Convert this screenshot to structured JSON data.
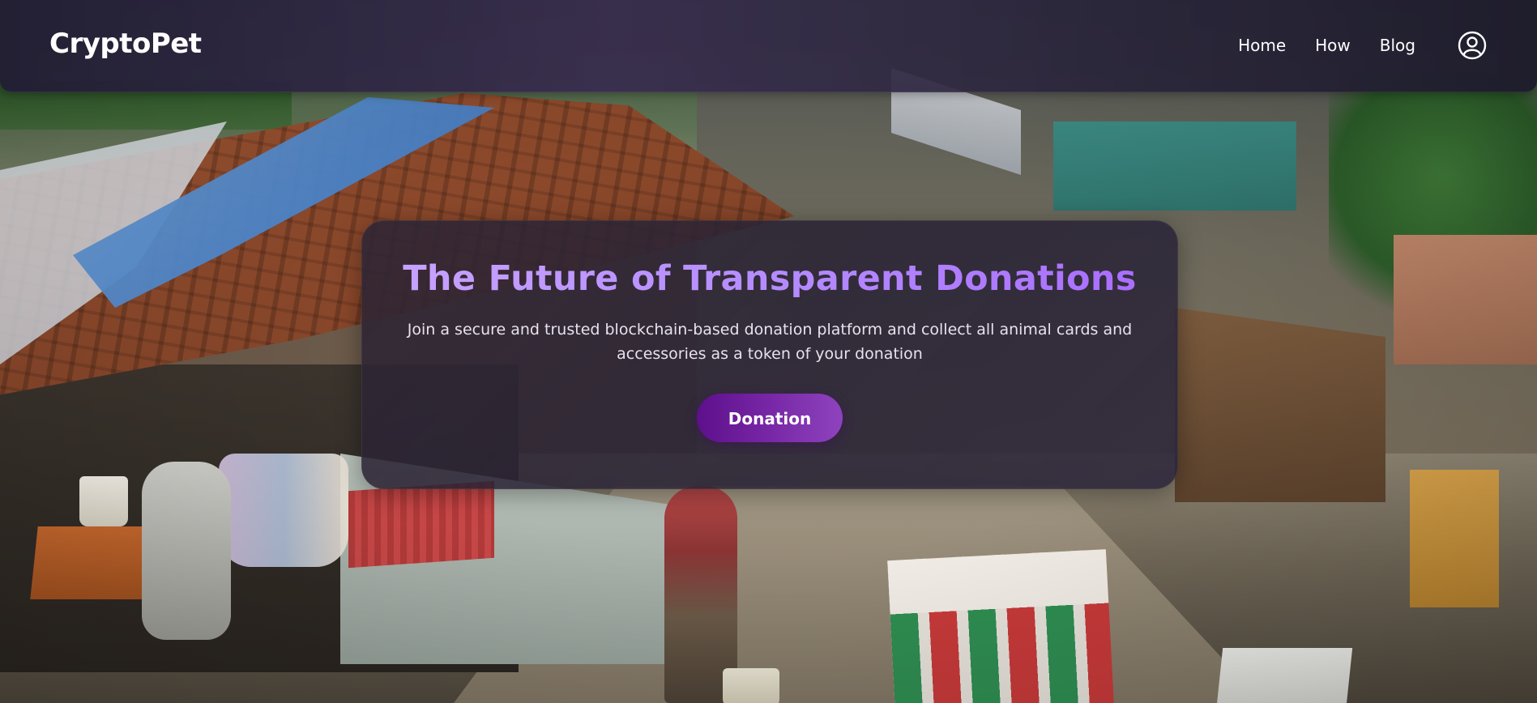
{
  "header": {
    "brand": "CryptoPet",
    "nav": [
      {
        "label": "Home"
      },
      {
        "label": "How"
      },
      {
        "label": "Blog"
      }
    ],
    "account_icon": "user-circle-icon"
  },
  "hero": {
    "title": "The Future of Transparent Donations",
    "subtitle": "Join a secure and trusted blockchain-based donation platform and collect all animal cards and accessories as a token of your donation",
    "cta_label": "Donation"
  },
  "colors": {
    "title_gradient_start": "#c9a4ff",
    "title_gradient_end": "#a86bff",
    "button_gradient_start": "#5e0f8c",
    "button_gradient_end": "#8e43bd",
    "header_bg": "#2a2440"
  }
}
